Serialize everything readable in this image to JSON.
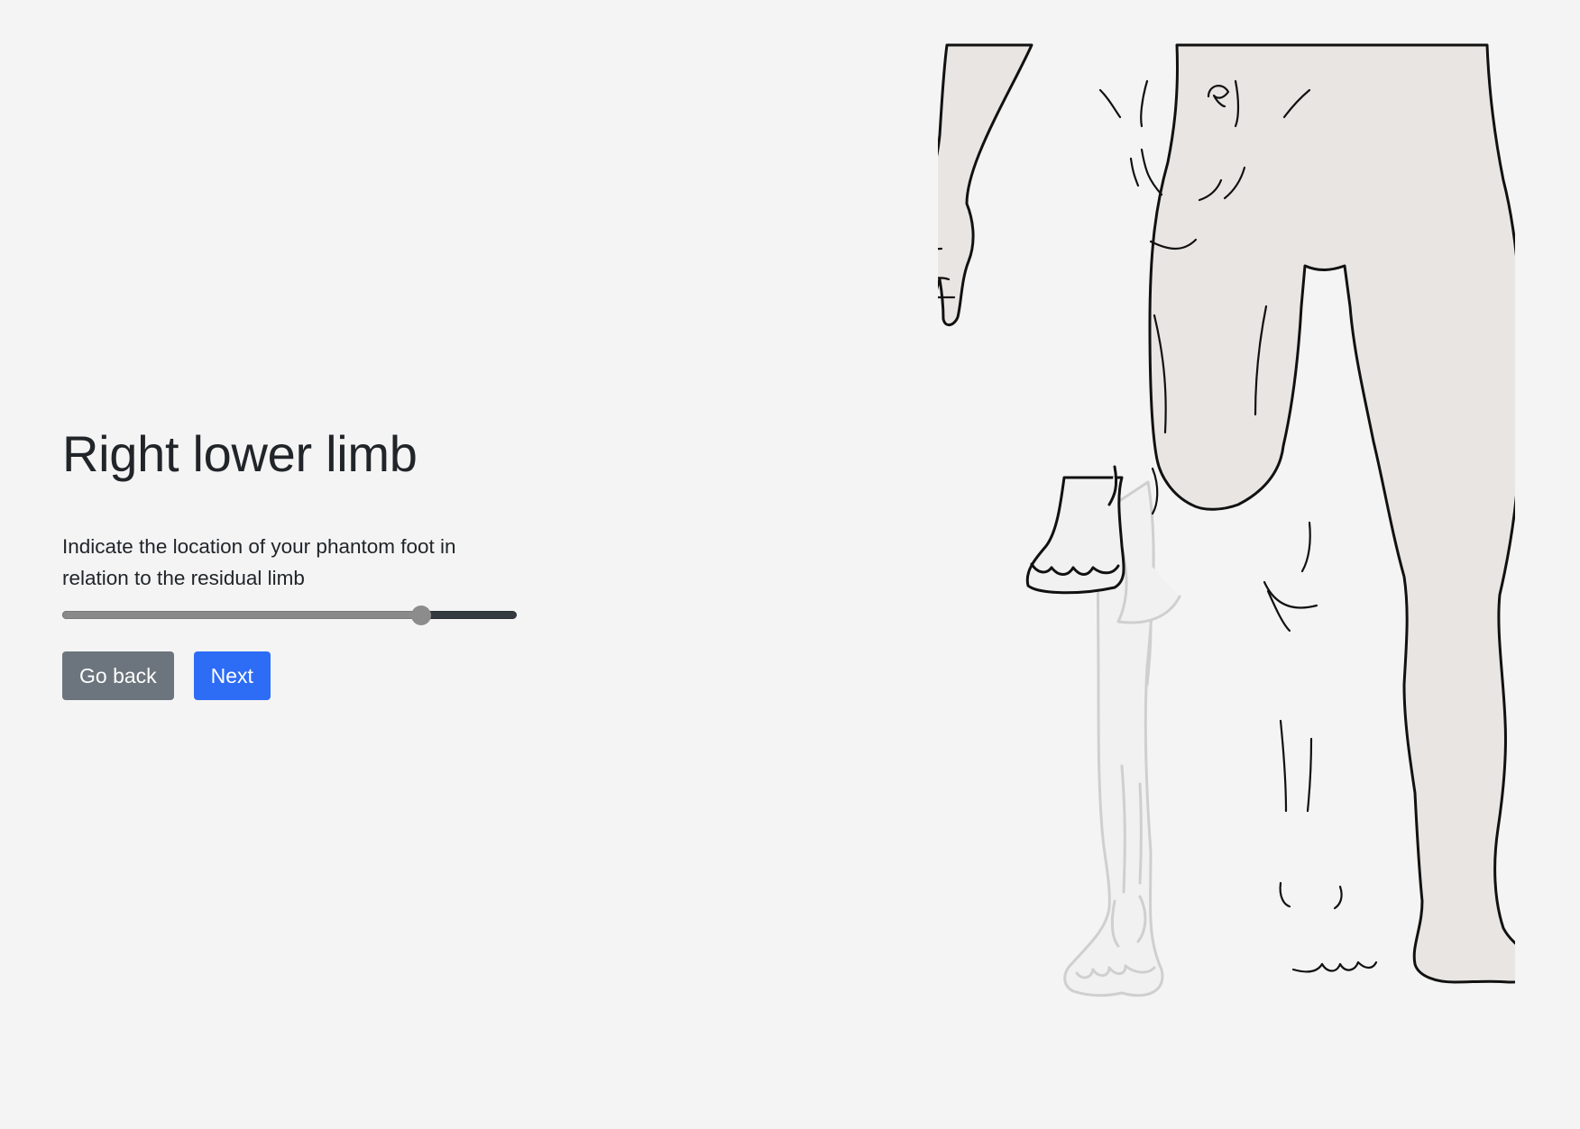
{
  "page": {
    "title": "Right lower limb",
    "instruction": "Indicate the location of your phantom foot in relation to the residual limb"
  },
  "slider": {
    "value_fraction": 0.79,
    "fill_color": "#8a8a8a",
    "track_color": "#343a40"
  },
  "buttons": {
    "back_label": "Go back",
    "next_label": "Next",
    "back_color": "#6c757d",
    "next_color": "#2d6cf5"
  },
  "figure": {
    "body_fill": "#e9e5e2",
    "outline_color": "#111111",
    "phantom_color": "#cfcfcf",
    "phantom_fill": "#f1f1f1"
  }
}
